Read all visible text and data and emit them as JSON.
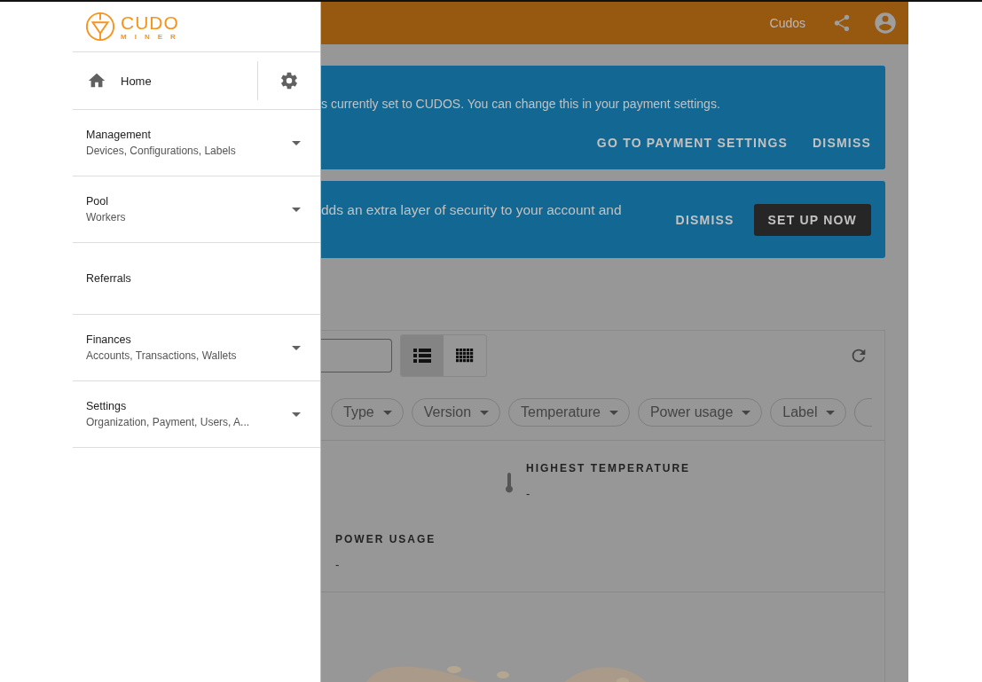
{
  "logo": {
    "top": "CUDO",
    "bottom": "MINER"
  },
  "sidebar": {
    "home": {
      "label": "Home"
    },
    "items": [
      {
        "kind": "group",
        "title": "Management",
        "subtitle": "Devices, Configurations, Labels"
      },
      {
        "kind": "group",
        "title": "Pool",
        "subtitle": "Workers"
      },
      {
        "kind": "link",
        "title": "Referrals"
      },
      {
        "kind": "group",
        "title": "Finances",
        "subtitle": "Accounts, Transactions, Wallets"
      },
      {
        "kind": "group",
        "title": "Settings",
        "subtitle": "Organization, Payment, Users, A..."
      }
    ]
  },
  "header": {
    "org": "Cudos"
  },
  "banners": [
    {
      "text": "s currently set to CUDOS. You can change this in your payment settings.",
      "actions": [
        {
          "label": "GO TO PAYMENT SETTINGS",
          "kind": "text"
        },
        {
          "label": "DISMISS",
          "kind": "text"
        }
      ]
    },
    {
      "text": "dds an extra layer of security to your account and",
      "actions": [
        {
          "label": "DISMISS",
          "kind": "text"
        },
        {
          "label": "SET UP NOW",
          "kind": "filled"
        }
      ]
    }
  ],
  "view_toggle": [
    {
      "kind": "list",
      "selected": true
    },
    {
      "kind": "grid",
      "selected": false
    }
  ],
  "filters": [
    {
      "label": "Type"
    },
    {
      "label": "Version"
    },
    {
      "label": "Temperature"
    },
    {
      "label": "Power usage"
    },
    {
      "label": "Label"
    }
  ],
  "stats": [
    {
      "kind": "temperature",
      "label": "HIGHEST TEMPERATURE",
      "value": "-"
    },
    {
      "kind": "power",
      "label": "POWER USAGE",
      "value": "-"
    }
  ]
}
